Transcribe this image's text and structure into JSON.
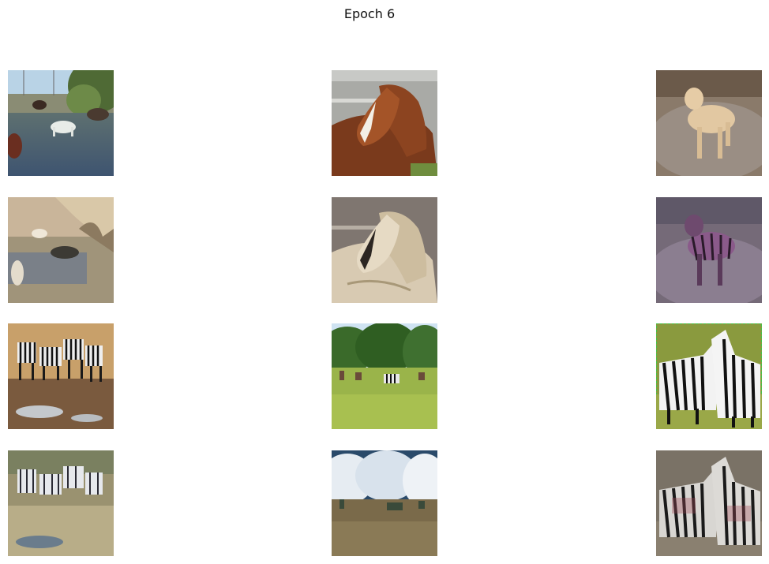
{
  "title": "Epoch 6",
  "images": [
    {
      "row": 0,
      "col": 0,
      "scene": "horses-in-river"
    },
    {
      "row": 0,
      "col": 1,
      "scene": "brown-horse-portrait"
    },
    {
      "row": 0,
      "col": 2,
      "scene": "pony-on-rock"
    },
    {
      "row": 1,
      "col": 0,
      "scene": "translated-horses-in-river"
    },
    {
      "row": 1,
      "col": 1,
      "scene": "translated-horse-portrait"
    },
    {
      "row": 1,
      "col": 2,
      "scene": "translated-striped-pony"
    },
    {
      "row": 2,
      "col": 0,
      "scene": "zebra-herd-at-water"
    },
    {
      "row": 2,
      "col": 1,
      "scene": "zebras-on-grass-field"
    },
    {
      "row": 2,
      "col": 2,
      "scene": "two-zebras-on-grass"
    },
    {
      "row": 3,
      "col": 0,
      "scene": "translated-zebra-herd"
    },
    {
      "row": 3,
      "col": 1,
      "scene": "translated-grass-field"
    },
    {
      "row": 3,
      "col": 2,
      "scene": "translated-two-zebras"
    }
  ]
}
